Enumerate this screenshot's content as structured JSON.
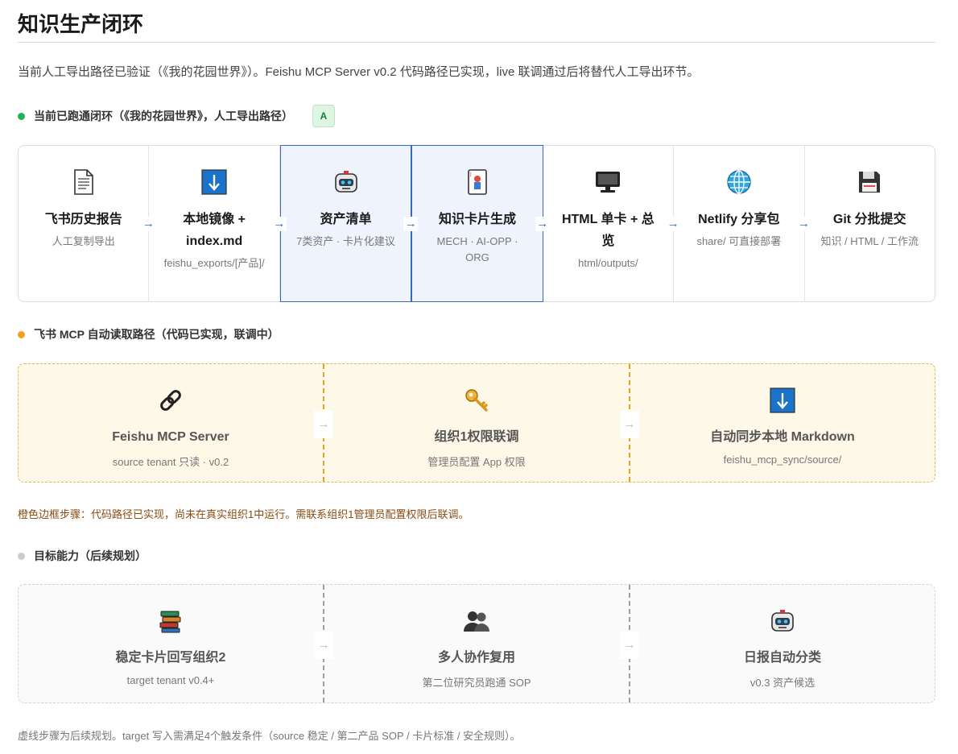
{
  "page_title": "知识生产闭环",
  "intro": "当前人工导出路径已验证（《我的花园世界》）。Feishu MCP Server v0.2 代码路径已实现，live 联调通过后将替代人工导出环节。",
  "section_a": {
    "heading": "当前已跑通闭环（《我的花园世界》，人工导出路径）",
    "badge": "A",
    "dot_color": "#22b35a",
    "steps": [
      {
        "icon": "document-icon",
        "title": "飞书历史报告",
        "sub": "人工复制导出"
      },
      {
        "icon": "download-arrow-icon",
        "title": "本地镜像 + index.md",
        "sub": "feishu_exports/[产品]/"
      },
      {
        "icon": "robot-icon",
        "title": "资产清单",
        "sub": "7类资产 · 卡片化建议"
      },
      {
        "icon": "card-icon",
        "title": "知识卡片生成",
        "sub": "MECH · AI-OPP · ORG"
      },
      {
        "icon": "monitor-icon",
        "title": "HTML 单卡 + 总览",
        "sub": "html/outputs/"
      },
      {
        "icon": "globe-icon",
        "title": "Netlify 分享包",
        "sub": "share/ 可直接部署"
      },
      {
        "icon": "floppy-disk-icon",
        "title": "Git 分批提交",
        "sub": "知识 / HTML / 工作流"
      }
    ],
    "highlight_color": "#3a66c4"
  },
  "section_b": {
    "heading": "飞书 MCP 自动读取路径（代码已实现，联调中）",
    "dot_color": "#f0a020",
    "steps": [
      {
        "icon": "link-icon",
        "title": "Feishu MCP Server",
        "sub": "source tenant 只读 · v0.2"
      },
      {
        "icon": "key-icon",
        "title": "组织1权限联调",
        "sub": "管理员配置 App 权限"
      },
      {
        "icon": "download-arrow-icon",
        "title": "自动同步本地 Markdown",
        "sub": "feishu_mcp_sync/source/"
      }
    ],
    "note": "橙色边框步骤：代码路径已实现，尚未在真实组织1中运行。需联系组织1管理员配置权限后联调。"
  },
  "section_c": {
    "heading": "目标能力（后续规划）",
    "dot_color": "#cccccc",
    "steps": [
      {
        "icon": "books-icon",
        "title": "稳定卡片回写组织2",
        "sub": "target tenant v0.4+"
      },
      {
        "icon": "people-icon",
        "title": "多人协作复用",
        "sub": "第二位研究员跑通 SOP"
      },
      {
        "icon": "robot-icon",
        "title": "日报自动分类",
        "sub": "v0.3 资产候选"
      }
    ],
    "note": "虚线步骤为后续规划。target 写入需满足4个触发条件（source 稳定 / 第二产品 SOP / 卡片标准 / 安全规则）。"
  },
  "arrow_glyph": "→"
}
